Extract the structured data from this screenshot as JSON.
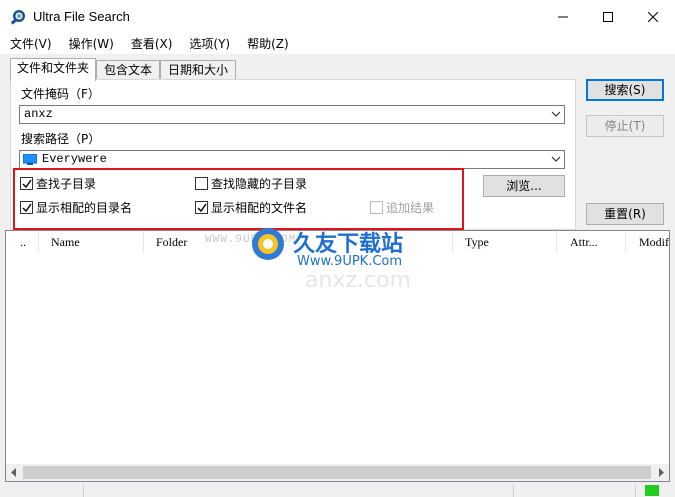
{
  "window": {
    "title": "Ultra File Search",
    "minimize_icon": "minimize-icon",
    "maximize_icon": "maximize-icon",
    "close_icon": "close-icon"
  },
  "menu": [
    {
      "label": "文件(V)"
    },
    {
      "label": "操作(W)"
    },
    {
      "label": "查看(X)"
    },
    {
      "label": "选项(Y)"
    },
    {
      "label": "帮助(Z)"
    }
  ],
  "tabs": [
    {
      "label": "文件和文件夹",
      "active": true
    },
    {
      "label": "包含文本",
      "active": false
    },
    {
      "label": "日期和大小",
      "active": false
    }
  ],
  "form": {
    "mask_label": "文件掩码（F）",
    "mask_value": "anxz",
    "path_label": "搜索路径（P）",
    "path_value": "Everywere",
    "browse_label": "浏览..."
  },
  "options": {
    "subdirs": {
      "label": "查找子目录",
      "checked": true
    },
    "hidden_subdirs": {
      "label": "查找隐藏的子目录",
      "checked": false
    },
    "show_dirs": {
      "label": "显示相配的目录名",
      "checked": true
    },
    "show_files": {
      "label": "显示相配的文件名",
      "checked": true
    },
    "append_results": {
      "label": "追加结果",
      "checked": false,
      "disabled": true
    }
  },
  "buttons": {
    "search": "搜索(S)",
    "stop": "停止(T)",
    "reset": "重置(R)"
  },
  "list": {
    "columns": [
      "..",
      "Name",
      "Folder",
      "Type",
      "Attr...",
      "Modif"
    ]
  },
  "watermark": {
    "site": "WWW.9UPK.COM",
    "brand": "久友下载站",
    "url": "Www.9UPK.Com",
    "overlay": "anxz.com"
  },
  "colors": {
    "highlight_border": "#e0121b",
    "accent": "#0078d7",
    "status_led": "#22cc22"
  }
}
